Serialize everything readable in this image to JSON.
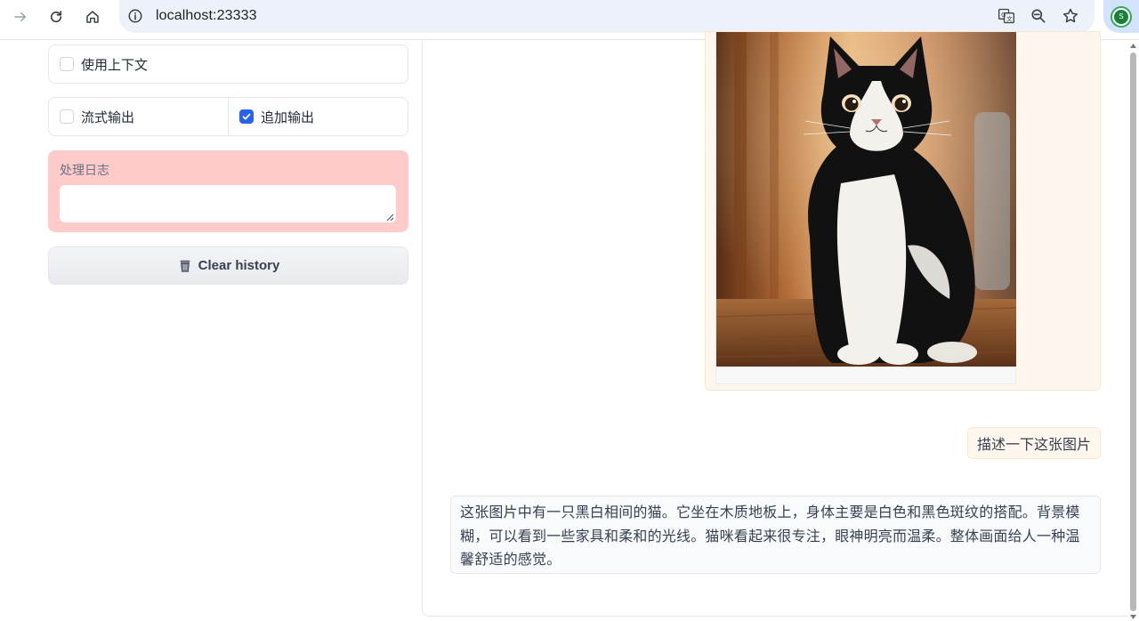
{
  "browser": {
    "url": "localhost:23333",
    "profile_initial": "S"
  },
  "settings": {
    "use_context_label": "使用上下文",
    "use_context_checked": false,
    "stream_output_label": "流式输出",
    "stream_output_checked": false,
    "append_output_label": "追加输出",
    "append_output_checked": true
  },
  "log": {
    "label": "处理日志",
    "value": ""
  },
  "clear_button": {
    "label": "Clear history",
    "icon": "trash-icon"
  },
  "chat": {
    "messages": [
      {
        "role": "user",
        "type": "image",
        "description_icon": "cat-photo"
      },
      {
        "role": "user",
        "type": "text",
        "text": "描述一下这张图片"
      },
      {
        "role": "assistant",
        "type": "text",
        "text": "这张图片中有一只黑白相间的猫。它坐在木质地板上，身体主要是白色和黑色斑纹的搭配。背景模糊，可以看到一些家具和柔和的光线。猫咪看起来很专注，眼神明亮而温柔。整体画面给人一种温馨舒适的感觉。"
      }
    ]
  },
  "colors": {
    "accent": "#2563eb",
    "log_background": "#fecaca",
    "user_bubble": "#fff7ed",
    "bot_bubble": "#f8fafc"
  }
}
